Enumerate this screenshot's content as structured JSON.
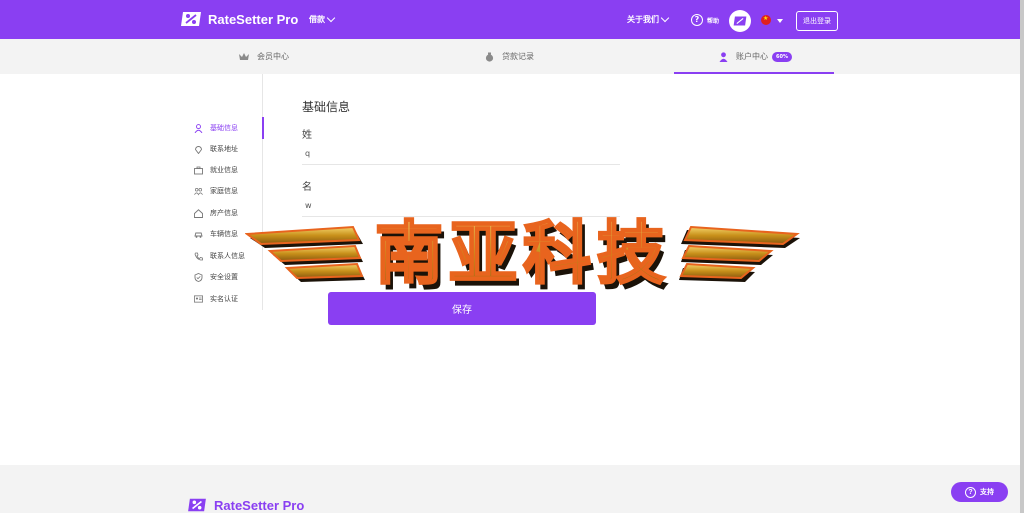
{
  "header": {
    "brand": "RateSetter Pro",
    "nav_borrow": "借款",
    "nav_about": "关于我们",
    "nav_help": "帮助",
    "logout": "退出登录"
  },
  "subtabs": [
    {
      "label": "会员中心",
      "icon": "crown-icon"
    },
    {
      "label": "贷款记录",
      "icon": "money-bag-icon"
    },
    {
      "label": "账户中心",
      "icon": "user-icon",
      "badge": "60%",
      "active": true
    }
  ],
  "sidebar": {
    "items": [
      {
        "label": "基础信息",
        "icon": "user-icon",
        "active": true
      },
      {
        "label": "联系地址",
        "icon": "location-pin-icon"
      },
      {
        "label": "就业信息",
        "icon": "briefcase-icon"
      },
      {
        "label": "家庭信息",
        "icon": "family-icon"
      },
      {
        "label": "房产信息",
        "icon": "house-icon"
      },
      {
        "label": "车辆信息",
        "icon": "car-icon"
      },
      {
        "label": "联系人信息",
        "icon": "phone-icon"
      },
      {
        "label": "安全设置",
        "icon": "shield-icon"
      },
      {
        "label": "实名认证",
        "icon": "id-card-icon"
      }
    ]
  },
  "form": {
    "title": "基础信息",
    "surname_label": "姓",
    "surname_value": "q",
    "given_label": "名",
    "given_value": "w",
    "save": "保存"
  },
  "watermark": {
    "text": "南亚科技"
  },
  "footer": {
    "brand": "RateSetter Pro",
    "support": "支持"
  },
  "colors": {
    "accent": "#8a3ff2",
    "watermark_gold": "#d9a520",
    "watermark_orange": "#e8641e"
  }
}
